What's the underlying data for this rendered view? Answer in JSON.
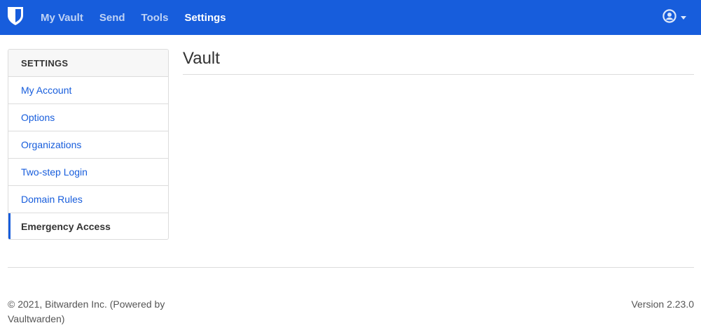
{
  "nav": {
    "logo": "bitwarden-shield-icon",
    "links": [
      {
        "label": "My Vault",
        "active": false
      },
      {
        "label": "Send",
        "active": false
      },
      {
        "label": "Tools",
        "active": false
      },
      {
        "label": "Settings",
        "active": true
      }
    ],
    "account_icon": "user-circle-icon",
    "colors": {
      "background": "#175ddc",
      "text": "#ffffff"
    }
  },
  "sidebar": {
    "header": "SETTINGS",
    "items": [
      {
        "label": "My Account",
        "active": false
      },
      {
        "label": "Options",
        "active": false
      },
      {
        "label": "Organizations",
        "active": false
      },
      {
        "label": "Two-step Login",
        "active": false
      },
      {
        "label": "Domain Rules",
        "active": false
      },
      {
        "label": "Emergency Access",
        "active": true
      }
    ]
  },
  "main": {
    "title": "Vault"
  },
  "footer": {
    "copyright": "© 2021, Bitwarden Inc. (Powered by Vaultwarden)",
    "version": "Version 2.23.0"
  }
}
